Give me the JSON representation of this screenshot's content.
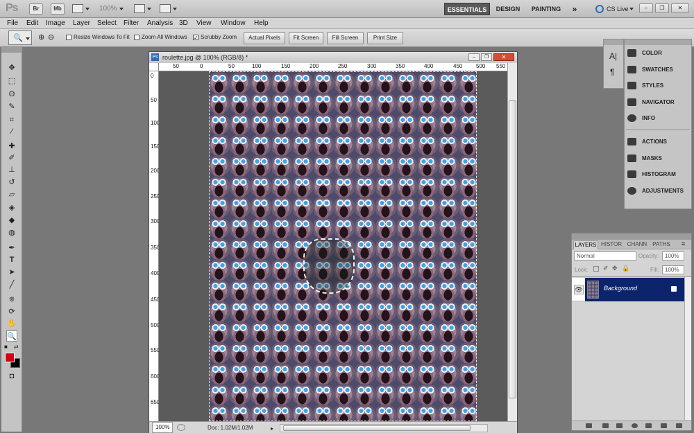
{
  "app": {
    "logo": "Ps",
    "bridge_btn": "Br",
    "minibridge_btn": "Mb",
    "zoom_level": "100%",
    "workspaces": [
      "ESSENTIALS",
      "DESIGN",
      "PAINTING"
    ],
    "more_workspaces": "»",
    "cs_live": "CS Live"
  },
  "menu": [
    "File",
    "Edit",
    "Image",
    "Layer",
    "Select",
    "Filter",
    "Analysis",
    "3D",
    "View",
    "Window",
    "Help"
  ],
  "options": {
    "resize_windows": "Resize Windows To Fit",
    "zoom_all": "Zoom All Windows",
    "scrubby_zoom": "Scrubby Zoom",
    "scrubby_checked": true,
    "buttons": [
      "Actual Pixels",
      "Fit Screen",
      "Fill Screen",
      "Print Size"
    ]
  },
  "document": {
    "title": "roulette.jpg @ 100% (RGB/8) *",
    "zoom": "100%",
    "doc_info": "Doc: 1.02M/1.02M",
    "ruler_h": [
      "50",
      "0",
      "50",
      "100",
      "150",
      "200",
      "250",
      "300",
      "350",
      "400",
      "450",
      "500",
      "550"
    ],
    "ruler_v": [
      "0",
      "50",
      "100",
      "150",
      "200",
      "250",
      "300",
      "350",
      "400",
      "450",
      "500",
      "550",
      "600",
      "650"
    ]
  },
  "dock": {
    "panels": [
      "COLOR",
      "SWATCHES",
      "STYLES",
      "NAVIGATOR",
      "INFO",
      "ACTIONS",
      "MASKS",
      "HISTOGRAM",
      "ADJUSTMENTS"
    ]
  },
  "layers_panel": {
    "tabs": [
      "LAYERS",
      "HISTOR",
      "CHANN",
      "PATHS"
    ],
    "blend_mode": "Normal",
    "opacity_label": "Opacity:",
    "opacity_value": "100%",
    "lock_label": "Lock:",
    "fill_label": "Fill:",
    "fill_value": "100%",
    "layer_name": "Background"
  },
  "colors": {
    "foreground": "#d40016",
    "background": "#000000",
    "accent_selected_layer": "#0b246c"
  }
}
